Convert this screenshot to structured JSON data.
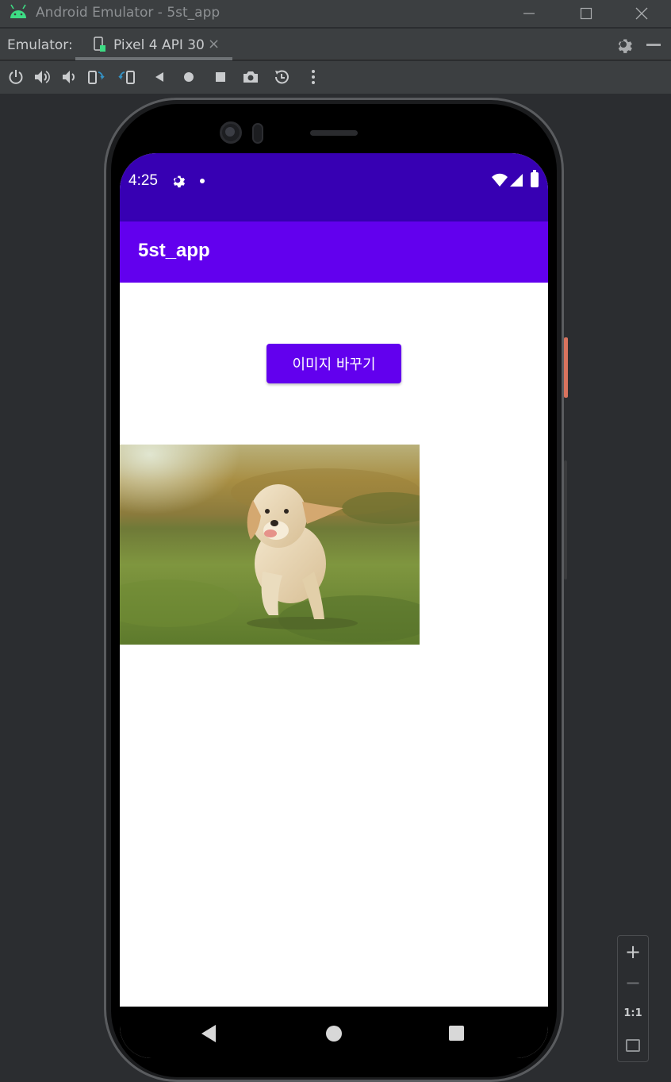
{
  "window": {
    "title": "Android Emulator - 5st_app",
    "minimize_icon": "minimize-icon",
    "maximize_icon": "maximize-icon",
    "close_icon": "close-icon"
  },
  "tabbar": {
    "label": "Emulator:",
    "active_tab": "Pixel 4 API 30",
    "tab_close": "×"
  },
  "toolbar": {
    "icons": [
      "power-icon",
      "volume-up-icon",
      "volume-down-icon",
      "rotate-left-icon",
      "rotate-right-icon",
      "back-icon",
      "home-icon",
      "overview-icon",
      "screenshot-icon",
      "snapshot-icon",
      "more-icon"
    ]
  },
  "device": {
    "status": {
      "time": "4:25"
    },
    "app_bar": {
      "title": "5st_app"
    },
    "content": {
      "button_label": "이미지 바꾸기",
      "image_alt": "golden retriever puppy on grass"
    }
  },
  "zoom": {
    "zoom_in": "+",
    "zoom_out": "−",
    "actual_size": "1:1"
  },
  "colors": {
    "status_bar": "#3700b3",
    "app_bar": "#6200ee",
    "button": "#6200ee",
    "ide_background": "#2b2d30"
  }
}
